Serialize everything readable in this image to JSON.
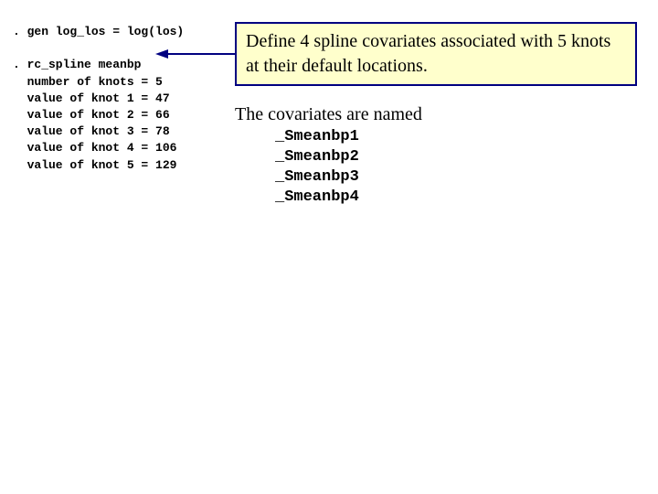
{
  "code": {
    "line1": ". gen log_los = log(los)",
    "blank1": "",
    "line2": ". rc_spline meanbp",
    "r1": "  number of knots = 5",
    "r2": "  value of knot 1 = 47",
    "r3": "  value of knot 2 = 66",
    "r4": "  value of knot 3 = 78",
    "r5": "  value of knot 4 = 106",
    "r6": "  value of knot 5 = 129"
  },
  "box1": {
    "text": "Define 4 spline covariates associated with 5 knots at their default locations."
  },
  "plain": {
    "intro": "The covariates are named",
    "c1": "_Smeanbp1",
    "c2": "_Smeanbp2",
    "c3": "_Smeanbp3",
    "c4": "_Smeanbp4"
  }
}
